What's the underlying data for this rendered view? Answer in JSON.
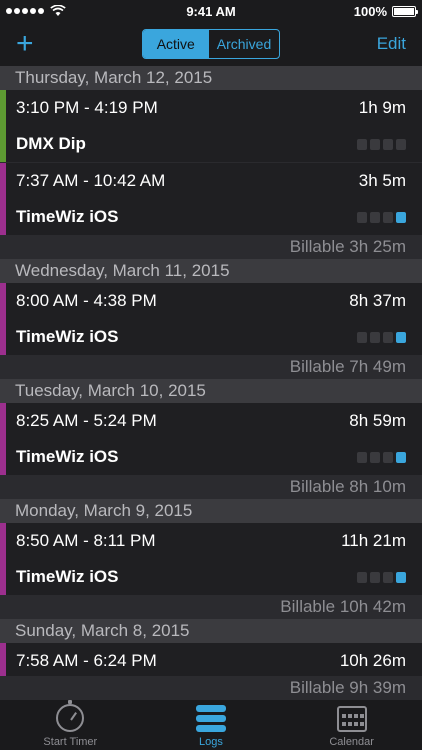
{
  "status": {
    "time": "9:41 AM",
    "battery": "100%"
  },
  "nav": {
    "add": "+",
    "edit": "Edit",
    "segments": [
      "Active",
      "Archived"
    ]
  },
  "days": [
    {
      "header": "Thursday, March 12, 2015",
      "entries": [
        {
          "range": "3:10 PM - 4:19 PM",
          "duration": "1h 9m",
          "project": "DMX Dip",
          "color": "#5d9a32",
          "billable": false
        },
        {
          "range": "7:37 AM - 10:42 AM",
          "duration": "3h 5m",
          "project": "TimeWiz iOS",
          "color": "#9c2f8e",
          "billable": true
        }
      ],
      "billable": "Billable 3h 25m"
    },
    {
      "header": "Wednesday, March 11, 2015",
      "entries": [
        {
          "range": "8:00 AM - 4:38 PM",
          "duration": "8h 37m",
          "project": "TimeWiz iOS",
          "color": "#9c2f8e",
          "billable": true
        }
      ],
      "billable": "Billable 7h 49m"
    },
    {
      "header": "Tuesday, March 10, 2015",
      "entries": [
        {
          "range": "8:25 AM - 5:24 PM",
          "duration": "8h 59m",
          "project": "TimeWiz iOS",
          "color": "#9c2f8e",
          "billable": true
        }
      ],
      "billable": "Billable 8h 10m"
    },
    {
      "header": "Monday, March 9, 2015",
      "entries": [
        {
          "range": "8:50 AM - 8:11 PM",
          "duration": "11h 21m",
          "project": "TimeWiz iOS",
          "color": "#9c2f8e",
          "billable": true
        }
      ],
      "billable": "Billable 10h 42m"
    },
    {
      "header": "Sunday, March 8, 2015",
      "entries": [
        {
          "range": "7:58 AM - 6:24 PM",
          "duration": "10h 26m",
          "project": "",
          "color": "#9c2f8e",
          "billable": true
        }
      ],
      "billable": "Billable 9h 39m"
    }
  ],
  "tabs": [
    "Start Timer",
    "Logs",
    "Calendar"
  ],
  "accent": "#3aa6dd"
}
